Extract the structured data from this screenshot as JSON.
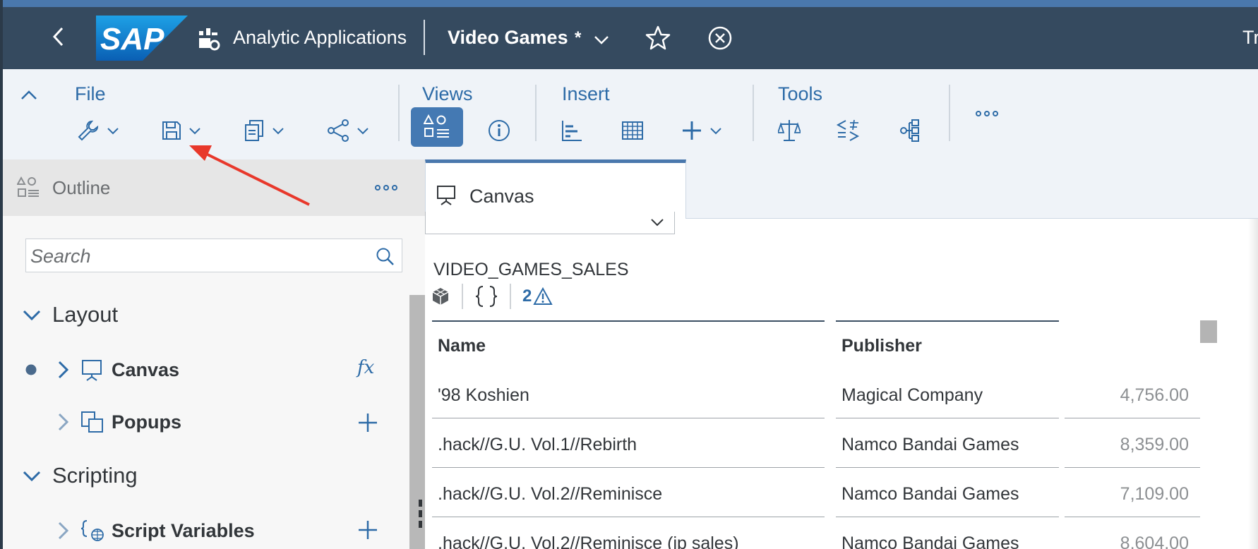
{
  "shell": {
    "app_name": "Analytic Applications",
    "document_title": "Video Games",
    "unsaved_marker": "*",
    "user_text_partial": "Tri"
  },
  "toolbar": {
    "groups": {
      "file": "File",
      "views": "Views",
      "insert": "Insert",
      "tools": "Tools"
    }
  },
  "outline": {
    "title": "Outline",
    "search_placeholder": "Search",
    "sections": {
      "layout": "Layout",
      "scripting": "Scripting"
    },
    "items": {
      "canvas": "Canvas",
      "popups": "Popups",
      "script_variables": "Script Variables"
    },
    "canvas_fx": "fx"
  },
  "canvas_tab": {
    "label": "Canvas"
  },
  "table": {
    "title": "VIDEO_GAMES_SALES",
    "warning_count": "2",
    "columns": {
      "name": "Name",
      "publisher": "Publisher"
    },
    "rows": [
      {
        "name": "'98 Koshien",
        "publisher": "Magical Company",
        "value": "4,756.00"
      },
      {
        "name": ".hack//G.U. Vol.1//Rebirth",
        "publisher": "Namco Bandai Games",
        "value": "8,359.00"
      },
      {
        "name": ".hack//G.U. Vol.2//Reminisce",
        "publisher": "Namco Bandai Games",
        "value": "7,109.00"
      },
      {
        "name": ".hack//G.U. Vol.2//Reminisce (jp sales)",
        "publisher": "Namco Bandai Games",
        "value": "8,604.00"
      }
    ]
  },
  "colors": {
    "shell_bg": "#354a5f",
    "toolbar_bg": "#eff3f8",
    "accent": "#2d6ba7",
    "active_view": "#4479b3",
    "annotation_arrow": "#e8382b"
  }
}
